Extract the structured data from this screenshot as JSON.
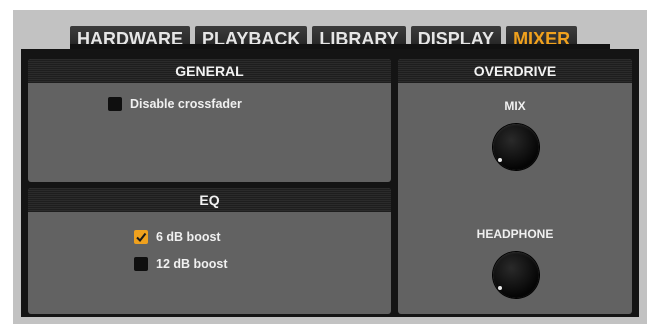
{
  "tabs": [
    {
      "label": "HARDWARE",
      "active": false
    },
    {
      "label": "PLAYBACK",
      "active": false
    },
    {
      "label": "LIBRARY",
      "active": false
    },
    {
      "label": "DISPLAY",
      "active": false
    },
    {
      "label": "MIXER",
      "active": true
    }
  ],
  "general": {
    "title": "GENERAL",
    "disable_crossfader": {
      "label": "Disable crossfader",
      "checked": false
    }
  },
  "eq": {
    "title": "EQ",
    "boost_6db": {
      "label": "6 dB boost",
      "checked": true
    },
    "boost_12db": {
      "label": "12 dB boost",
      "checked": false
    }
  },
  "overdrive": {
    "title": "OVERDRIVE",
    "mix_label": "MIX",
    "headphone_label": "HEADPHONE"
  },
  "colors": {
    "accent": "#f0a11d",
    "panel": "#626262",
    "frame": "#141414"
  }
}
